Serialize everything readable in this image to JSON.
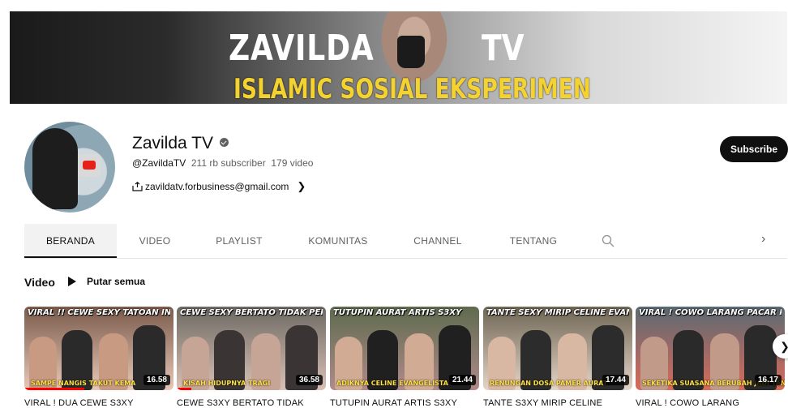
{
  "banner": {
    "title_left": "ZAVILDA",
    "title_right": "TV",
    "subtitle": "ISLAMIC SOSIAL EKSPERIMEN",
    "accent_color": "#f4d230"
  },
  "channel": {
    "name": "Zavilda TV",
    "handle": "@ZavildaTV",
    "subscribers": "211 rb subscriber",
    "videos": "179 video",
    "link": "zavildatv.forbusiness@gmail.com",
    "verified_icon": "verified-check-icon"
  },
  "subscribe_label": "Subscribe",
  "tabs": [
    {
      "label": "BERANDA",
      "active": true
    },
    {
      "label": "VIDEO"
    },
    {
      "label": "PLAYLIST"
    },
    {
      "label": "KOMUNITAS"
    },
    {
      "label": "CHANNEL"
    },
    {
      "label": "TENTANG"
    }
  ],
  "section": {
    "title": "Video",
    "play_all": "Putar semua"
  },
  "videos": [
    {
      "thumb_title": "VIRAL !! CEWE SEXY TATOAN INSYAF",
      "thumb_caption": "SAMPE NANGIS TAKUT KEMA",
      "duration": "16.58",
      "title": "VIRAL ! DUA CEWE S3XY",
      "progress": 0.4
    },
    {
      "thumb_title": "CEWE SEXY BERTATO TIDAK PERCAYA ADANYA TUHAN",
      "thumb_caption": "KISAH HIDUPNYA TRAGI",
      "duration": "36.58",
      "title": "CEWE S3XY BERTATO TIDAK",
      "progress": 0.1
    },
    {
      "thumb_title": "TUTUPIN AURAT ARTIS S3XY",
      "thumb_caption": "ADIKNYA CELINE EVANGELISTA",
      "duration": "21.44",
      "title": "TUTUPIN AURAT ARTIS S3XY",
      "progress": 0
    },
    {
      "thumb_title": "TANTE SEXY MIRIP CELINE EVANGELISTA HIJRAH",
      "thumb_caption": "RENUNGAN DOSA PAMER AURAT",
      "duration": "17.44",
      "title": "TANTE S3XY MIRIP CELINE",
      "progress": 0
    },
    {
      "thumb_title": "VIRAL ! COWO LARANG PACAR NYA BERHIJAB",
      "thumb_caption": "SEKETIKA SUASANA BERUBAH JADI TANGIS",
      "duration": "16.17",
      "title": "VIRAL ! COWO LARANG",
      "progress": 0
    }
  ],
  "thumb_palettes": [
    [
      "#7a5a4a",
      "#c89a82",
      "#2a2a2a",
      "#e8c8b8"
    ],
    [
      "#6d6a63",
      "#c7a596",
      "#3a3434",
      "#d9c0b5"
    ],
    [
      "#5e6b4e",
      "#d1ab94",
      "#202020",
      "#b08a8a"
    ],
    [
      "#6f6654",
      "#d8b7a3",
      "#2c2c2c",
      "#e5d5c8"
    ],
    [
      "#5a6a73",
      "#c19a8a",
      "#2a2a2a",
      "#d96a5a"
    ]
  ]
}
